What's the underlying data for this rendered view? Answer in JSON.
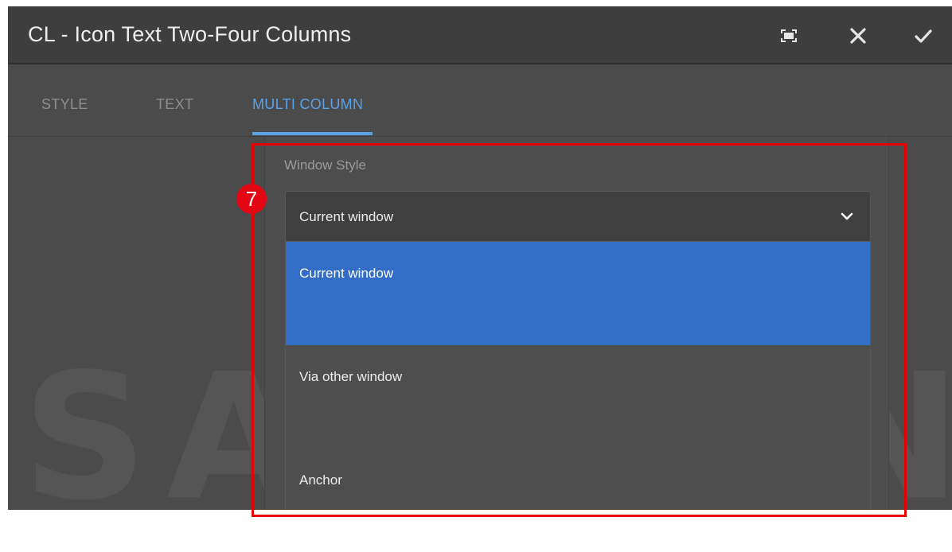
{
  "dialog": {
    "title": "CL - Icon Text Two-Four Columns",
    "toolbar": {
      "fullscreen_icon": "fullscreen-icon",
      "close_icon": "close-icon",
      "confirm_icon": "checkmark-icon"
    }
  },
  "tabs": [
    {
      "label": "STYLE",
      "active": false
    },
    {
      "label": "TEXT",
      "active": false
    },
    {
      "label": "MULTI COLUMN",
      "active": true
    }
  ],
  "field": {
    "label": "Window Style",
    "value": "Current window",
    "chevron_icon": "chevron-down-icon",
    "options": [
      {
        "label": "Current window",
        "selected": true
      },
      {
        "label": "Via other window",
        "selected": false
      },
      {
        "label": "Anchor",
        "selected": false
      }
    ]
  },
  "annotation": {
    "badge_number": "7",
    "color": "#e60000"
  },
  "watermark": "SAMSUNG",
  "colors": {
    "accent": "#5aa1ea",
    "selection": "#326dc8",
    "titlebar": "#3e3e3e",
    "background": "#4b4b4b"
  }
}
